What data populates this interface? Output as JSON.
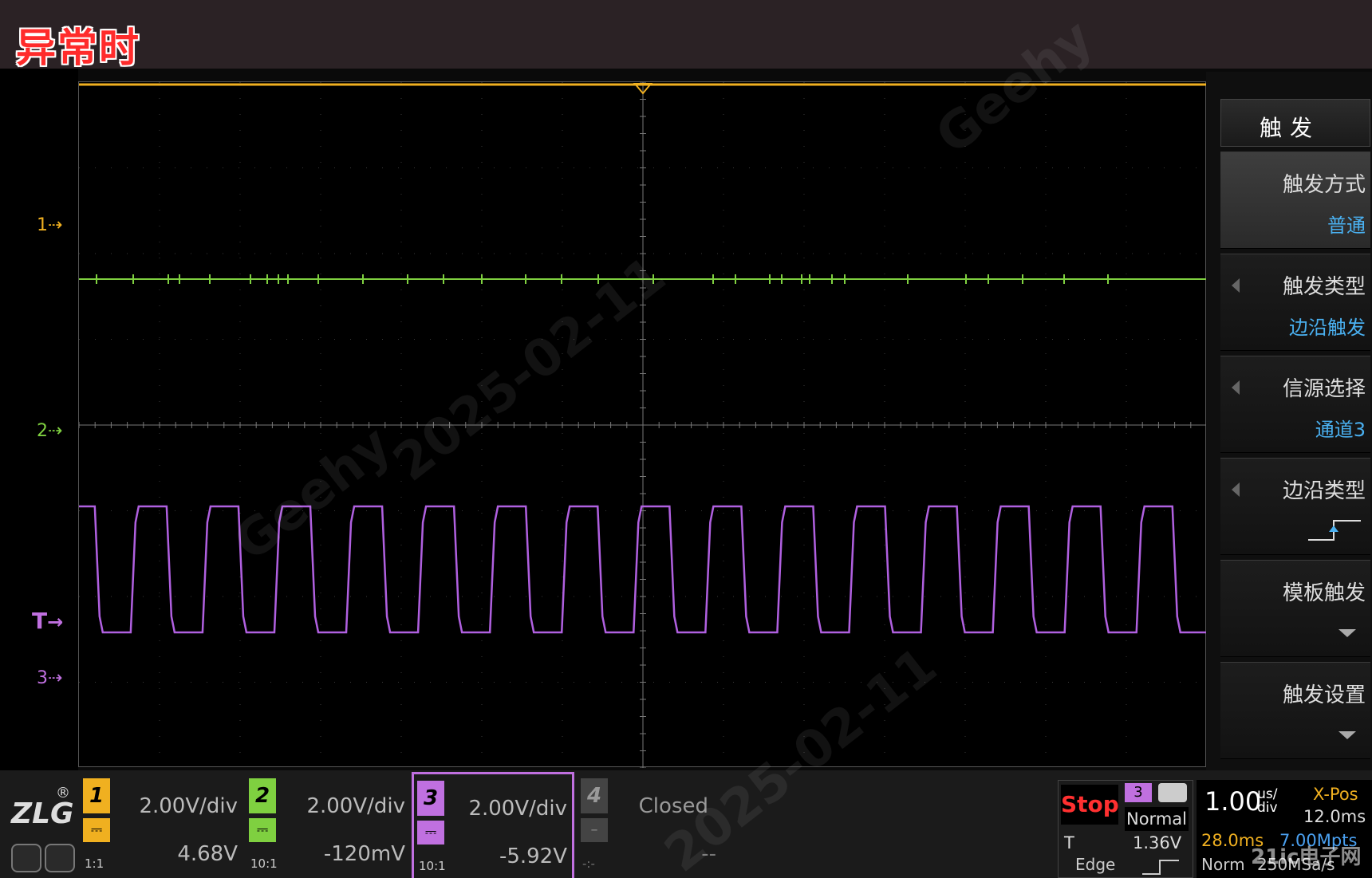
{
  "banner": {
    "label": "异常时"
  },
  "watermark": {
    "brand": "Geehy",
    "date": "2025-02-11"
  },
  "site_mark": "21ic电子网",
  "channels_markers": [
    {
      "label": "1",
      "color": "#f0b020"
    },
    {
      "label": "2",
      "color": "#7fd040"
    },
    {
      "label": "T",
      "color": "#c070e0"
    },
    {
      "label": "3",
      "color": "#c070e0"
    }
  ],
  "trigger_menu": {
    "title": "触发",
    "items": [
      {
        "label": "触发方式",
        "value": "普通",
        "active": true
      },
      {
        "label": "触发类型",
        "value": "边沿触发",
        "arrow": true
      },
      {
        "label": "信源选择",
        "value": "通道3",
        "arrow": true
      },
      {
        "label": "边沿类型",
        "value_icon": "rising-edge-icon",
        "arrow": true
      },
      {
        "label": "模板触发",
        "value_icon": "chevron-down-icon"
      },
      {
        "label": "触发设置",
        "value_icon": "chevron-down-icon"
      }
    ]
  },
  "logo": {
    "text": "ZLG",
    "reg": "®"
  },
  "channel_settings": [
    {
      "num": "1",
      "scale": "2.00V/div",
      "offset": "4.68V",
      "ratio": "1:1",
      "color": "#f0b020",
      "state": "on"
    },
    {
      "num": "2",
      "scale": "2.00V/div",
      "offset": "-120mV",
      "ratio": "10:1",
      "color": "#7fd040",
      "state": "on"
    },
    {
      "num": "3",
      "scale": "2.00V/div",
      "offset": "-5.92V",
      "ratio": "10:1",
      "color": "#c070e0",
      "state": "selected"
    },
    {
      "num": "4",
      "scale": "Closed",
      "offset": "--",
      "ratio": "-:-",
      "color": "#555555",
      "state": "closed"
    }
  ],
  "trigger_status": {
    "run_state": "Stop",
    "source": "3",
    "mode": "Normal",
    "T_label": "T",
    "level": "1.36V",
    "type": "Edge"
  },
  "timebase": {
    "scale": "1.00",
    "unit_top": "us/",
    "unit_bottom": "div",
    "xpos_label": "X-Pos",
    "xpos_value": "12.0ms",
    "sample_time": "28.0ms",
    "memory_depth": "7.00Mpts",
    "acq_mode": "Norm",
    "sample_rate": "250MSa/s"
  },
  "waveform": {
    "channel_3_square_wave_cycles": 15,
    "channel_2_state": "flat with glitches"
  }
}
